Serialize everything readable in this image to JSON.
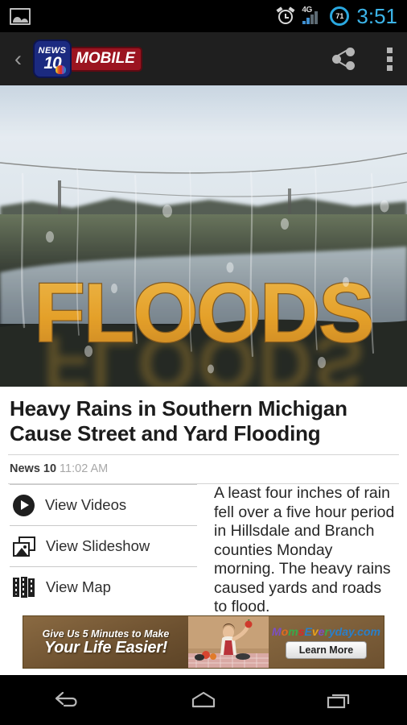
{
  "statusbar": {
    "photo_icon": "photo-icon",
    "alarm_icon": "alarm-icon",
    "network": "4G",
    "battery_level": "71",
    "time": "3:51"
  },
  "appbar": {
    "back_label": "‹",
    "logo_top": "NEWS",
    "logo_number": "10",
    "logo_tag": "MOBILE",
    "share_icon": "share-icon",
    "menu_icon": "overflow-menu-icon"
  },
  "hero": {
    "overlay_text": "FLOODS",
    "alt": "Rain-streaked window overlooking a flooded road"
  },
  "article": {
    "headline": "Heavy Rains in Southern Michigan Cause Street and Yard Flooding",
    "source": "News 10",
    "timestamp": "11:02 AM",
    "body": "A least four inches of rain fell over a five hour period in Hillsdale and Branch counties Monday morning. The heavy rains caused yards and roads to flood."
  },
  "actions": [
    {
      "label": "View Videos",
      "icon": "play-circle-icon"
    },
    {
      "label": "View Slideshow",
      "icon": "photo-stack-icon"
    },
    {
      "label": "View Map",
      "icon": "folded-map-icon"
    }
  ],
  "ad": {
    "line1": "Give Us 5 Minutes to Make",
    "line2": "Your Life Easier!",
    "brand_letters": [
      "M",
      "o",
      "m",
      "s",
      "E",
      "v",
      "e",
      "r",
      "yday.com"
    ],
    "brand": "MomsEveryday.com",
    "cta": "Learn More"
  },
  "navbar": [
    {
      "label": "Back",
      "icon": "back-arrow-icon"
    },
    {
      "label": "Home",
      "icon": "home-icon"
    },
    {
      "label": "Recent apps",
      "icon": "recent-apps-icon"
    }
  ],
  "colors": {
    "status_time": "#3cb4e8",
    "appbar_bg": "#1f1f1f",
    "logo_blue": "#1b2a80",
    "logo_red": "#9b1420",
    "flood_gold": "#e8a317",
    "ad_brown": "#6d5130"
  }
}
